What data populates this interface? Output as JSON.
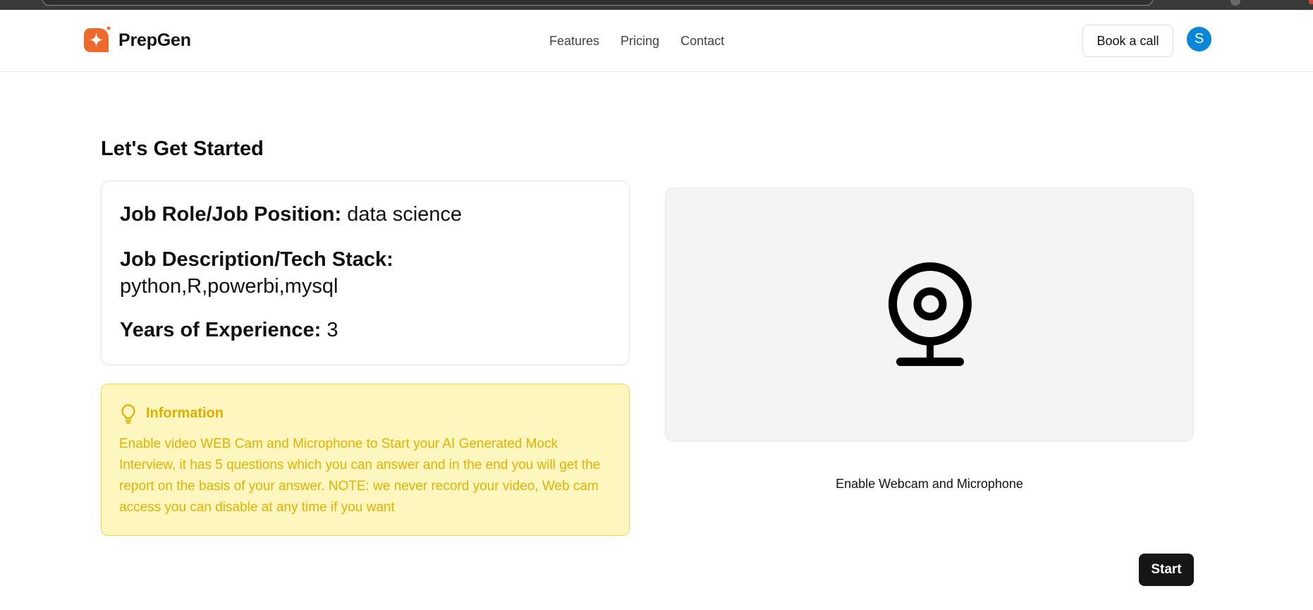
{
  "brand": {
    "name": "PrepGen",
    "logo_color": "#f06a2a"
  },
  "nav": {
    "items": [
      "Features",
      "Pricing",
      "Contact"
    ]
  },
  "header": {
    "book_call_label": "Book a call",
    "avatar_initial": "S",
    "avatar_color": "#0a86d8"
  },
  "page": {
    "title": "Let's Get Started"
  },
  "details": {
    "job_role_label": "Job Role/Job Position:",
    "job_role_value": "data science",
    "job_desc_label": "Job Description/Tech Stack:",
    "job_desc_value": "python,R,powerbi,mysql",
    "experience_label": "Years of Experience:",
    "experience_value": "3"
  },
  "info": {
    "icon": "lightbulb-icon",
    "title": "Information",
    "text": "Enable video WEB Cam and Microphone to Start your AI Generated Mock Interview, it has 5 questions which you can answer and in the end you will get the report on the basis of your answer. NOTE: we never record your video, Web cam access you can disable at any time if you want"
  },
  "webcam": {
    "icon": "webcam-icon",
    "enable_label": "Enable Webcam and Microphone"
  },
  "actions": {
    "start_label": "Start"
  }
}
